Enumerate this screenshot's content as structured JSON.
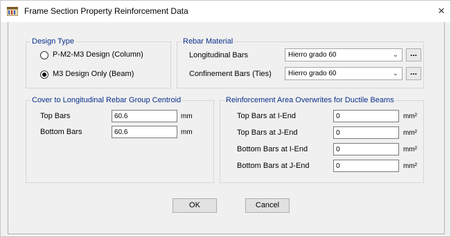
{
  "window": {
    "title": "Frame Section Property Reinforcement Data",
    "close_glyph": "×"
  },
  "design_type": {
    "legend": "Design Type",
    "options": [
      {
        "label": "P-M2-M3 Design  (Column)",
        "selected": false
      },
      {
        "label": "M3 Design Only  (Beam)",
        "selected": true
      }
    ]
  },
  "rebar_material": {
    "legend": "Rebar Material",
    "longitudinal": {
      "label": "Longitudinal Bars",
      "value": "Hierro grado 60"
    },
    "confinement": {
      "label": "Confinement Bars (Ties)",
      "value": "Hierro grado 60"
    },
    "dots_label": "..."
  },
  "cover": {
    "legend": "Cover to Longitudinal Rebar Group Centroid",
    "top": {
      "label": "Top Bars",
      "value": "60.6",
      "unit": "mm"
    },
    "bottom": {
      "label": "Bottom  Bars",
      "value": "60.6",
      "unit": "mm"
    }
  },
  "overwrites": {
    "legend": "Reinforcement Area Overwrites for Ductile Beams",
    "rows": [
      {
        "label": "Top Bars at I-End",
        "value": "0",
        "unit": "mm²"
      },
      {
        "label": "Top Bars at J-End",
        "value": "0",
        "unit": "mm²"
      },
      {
        "label": "Bottom Bars at I-End",
        "value": "0",
        "unit": "mm²"
      },
      {
        "label": "Bottom Bars at J-End",
        "value": "0",
        "unit": "mm²"
      }
    ]
  },
  "buttons": {
    "ok": "OK",
    "cancel": "Cancel"
  },
  "icons": {
    "app": "frame-section-icon",
    "dropdown": "chevron-down-icon"
  }
}
